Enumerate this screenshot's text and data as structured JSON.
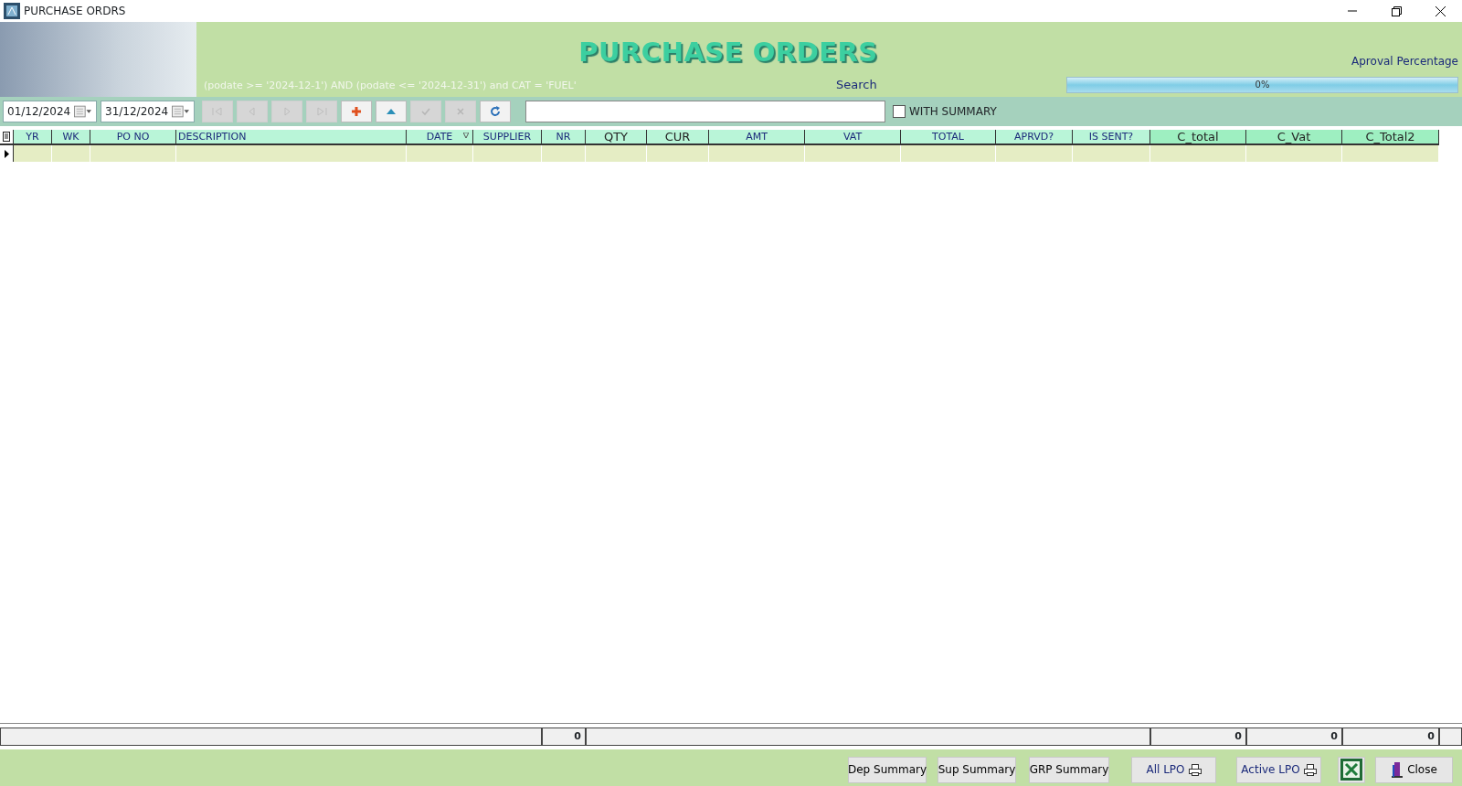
{
  "window": {
    "title": "PURCHASE ORDRS"
  },
  "header": {
    "title": "PURCHASE ORDERS",
    "filter": "(podate >= '2024-12-1') AND  (podate  <= '2024-12-31') and CAT  = 'FUEL'",
    "search_label": "Search",
    "approval_label": "Aproval Percentage",
    "approval": {
      "level": 0,
      "reading": "0%"
    }
  },
  "toolbar": {
    "date_from": "01/12/2024",
    "date_to": "31/12/2024",
    "nav_buttons": [
      {
        "kind": "first",
        "disabled": true
      },
      {
        "kind": "prev",
        "disabled": true
      },
      {
        "kind": "next",
        "disabled": true
      },
      {
        "kind": "last",
        "disabled": true
      },
      {
        "kind": "add",
        "disabled": false
      },
      {
        "kind": "edit",
        "disabled": false
      },
      {
        "kind": "save",
        "disabled": true
      },
      {
        "kind": "cancel",
        "disabled": true
      },
      {
        "kind": "refresh",
        "disabled": false
      }
    ],
    "with_summary": {
      "label": "WITH SUMMARY",
      "checked": false
    }
  },
  "table": {
    "columns": [
      {
        "label": "YR",
        "kind": "data",
        "sorted": false
      },
      {
        "label": "WK",
        "kind": "data",
        "sorted": false
      },
      {
        "label": "PO NO",
        "kind": "data",
        "sorted": false
      },
      {
        "label": "DESCRIPTION",
        "kind": "left",
        "sorted": false
      },
      {
        "label": "DATE",
        "kind": "data",
        "sorted": true
      },
      {
        "label": "SUPPLIER",
        "kind": "data",
        "sorted": false
      },
      {
        "label": "NR",
        "kind": "data",
        "sorted": false
      },
      {
        "label": "QTY",
        "kind": "large",
        "sorted": false
      },
      {
        "label": "CUR",
        "kind": "large",
        "sorted": false
      },
      {
        "label": "AMT",
        "kind": "data",
        "sorted": false
      },
      {
        "label": "VAT",
        "kind": "data",
        "sorted": false
      },
      {
        "label": "TOTAL",
        "kind": "data",
        "sorted": false
      },
      {
        "label": "APRVD?",
        "kind": "data",
        "sorted": false
      },
      {
        "label": "IS SENT?",
        "kind": "data",
        "sorted": false
      },
      {
        "label": "C_total",
        "kind": "computed",
        "sorted": false
      },
      {
        "label": "C_Vat",
        "kind": "computed",
        "sorted": false
      },
      {
        "label": "C_Total2",
        "kind": "computed",
        "sorted": false
      }
    ],
    "rows": [
      {
        "selected": true
      }
    ],
    "totals": [
      "0",
      "0",
      "0",
      "0"
    ]
  },
  "buttons": [
    {
      "label": "Dep Summary",
      "kind": "text"
    },
    {
      "label": "Sup Summary",
      "kind": "text"
    },
    {
      "label": "GRP Summary",
      "kind": "text"
    },
    {
      "label": "All LPO",
      "kind": "print"
    },
    {
      "label": "Active LPO",
      "kind": "print"
    },
    {
      "kind": "excel"
    },
    {
      "label": "Close",
      "kind": "close"
    }
  ]
}
